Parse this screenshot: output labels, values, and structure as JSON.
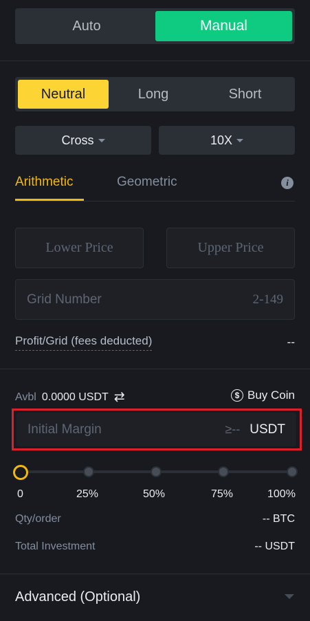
{
  "mode": {
    "auto": "Auto",
    "manual": "Manual"
  },
  "direction": {
    "neutral": "Neutral",
    "long": "Long",
    "short": "Short"
  },
  "margin_mode": {
    "value": "Cross"
  },
  "leverage": {
    "value": "10X"
  },
  "tabs": {
    "arithmetic": "Arithmetic",
    "geometric": "Geometric"
  },
  "fields": {
    "lower_price": "Lower Price",
    "upper_price": "Upper Price",
    "grid_number": "Grid Number",
    "grid_range": "2-149"
  },
  "profit": {
    "label": "Profit/Grid (fees deducted)",
    "value": "--"
  },
  "balance": {
    "label": "Avbl",
    "value": "0.0000 USDT",
    "buy_coin": "Buy Coin"
  },
  "margin": {
    "placeholder": "Initial Margin",
    "min": "≥--",
    "unit": "USDT"
  },
  "slider": {
    "value_percent": 0,
    "marks": [
      "0",
      "25%",
      "50%",
      "75%",
      "100%"
    ]
  },
  "qty": {
    "label": "Qty/order",
    "value": "-- BTC"
  },
  "investment": {
    "label": "Total Investment",
    "value": "-- USDT"
  },
  "advanced": {
    "label": "Advanced (Optional)"
  },
  "colors": {
    "accent_green": "#0ecb81",
    "accent_yellow": "#f0b90b",
    "highlight_red": "#d9202c"
  }
}
